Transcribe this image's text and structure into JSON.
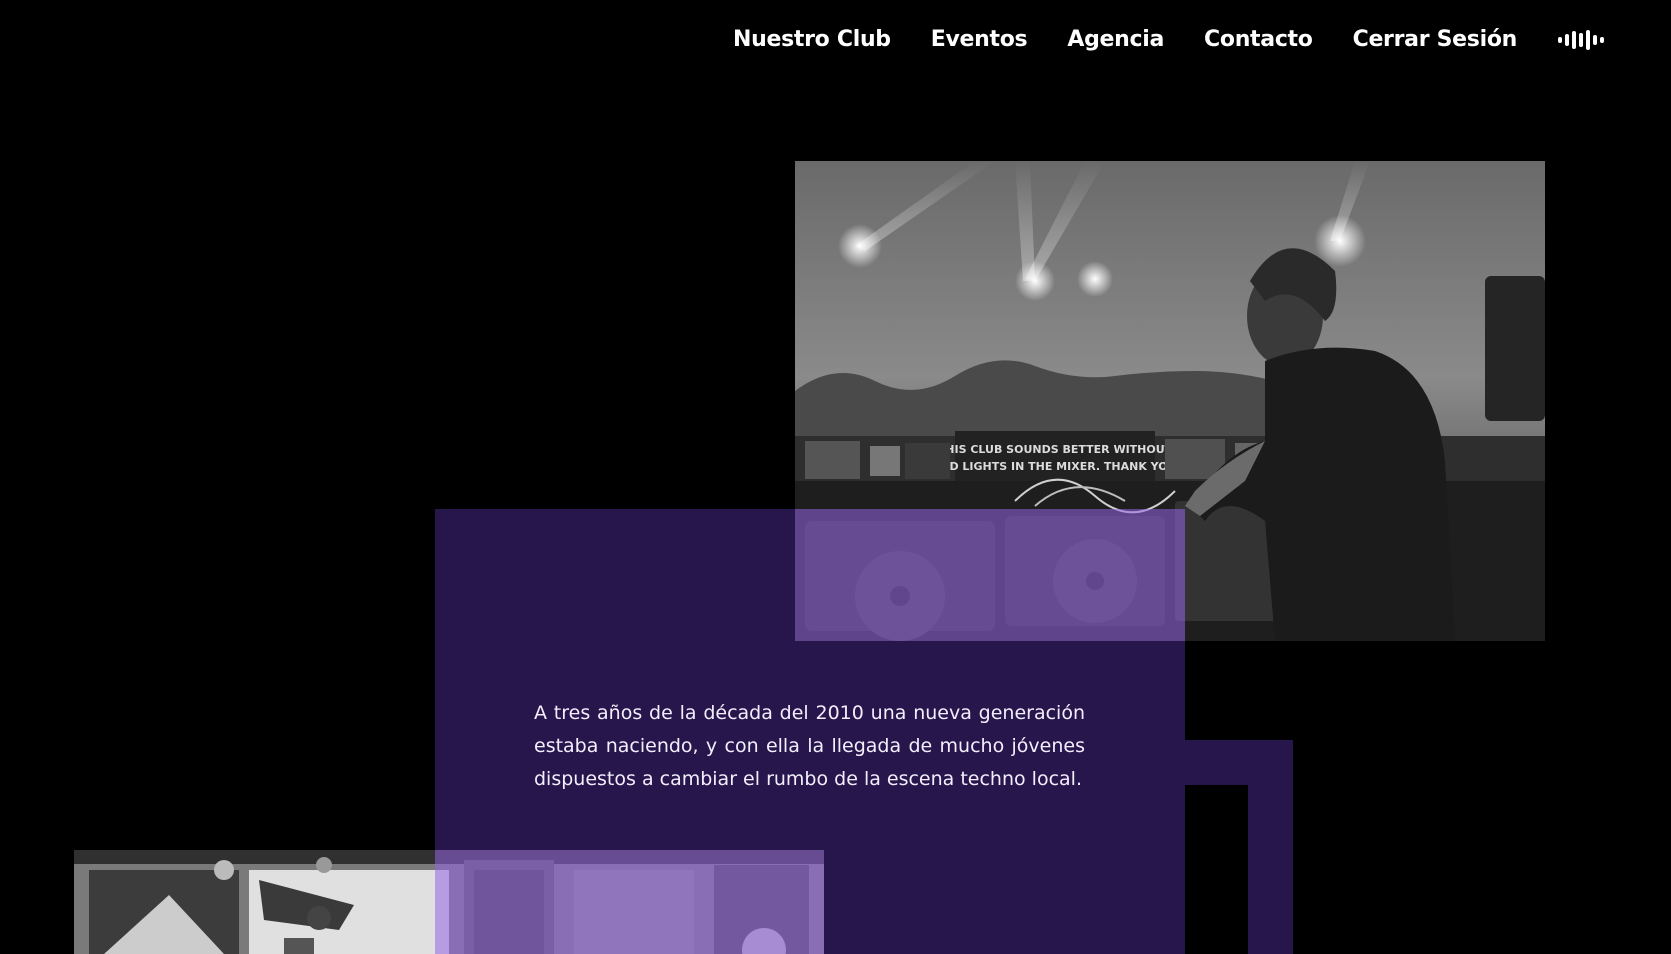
{
  "nav": {
    "items": [
      {
        "label": "Nuestro Club"
      },
      {
        "label": "Eventos"
      },
      {
        "label": "Agencia"
      },
      {
        "label": "Contacto"
      },
      {
        "label": "Cerrar Sesión"
      }
    ],
    "sound_icon": "sound-wave-icon"
  },
  "hero": {
    "banner_line1": "THIS CLUB SOUNDS BETTER WITHOUT",
    "banner_line2": "RED LIGHTS IN THE MIXER. THANK YOU"
  },
  "intro": {
    "text": "A tres años de la década del 2010 una nueva generación estaba naciendo, y con ella la llegada de mucho jóvenes dispuestos a cambiar el rumbo de la escena techno local."
  },
  "colors": {
    "background": "#000000",
    "purple_block": "#27164c",
    "purple_tint": "#9664e6",
    "text": "#ffffff"
  }
}
